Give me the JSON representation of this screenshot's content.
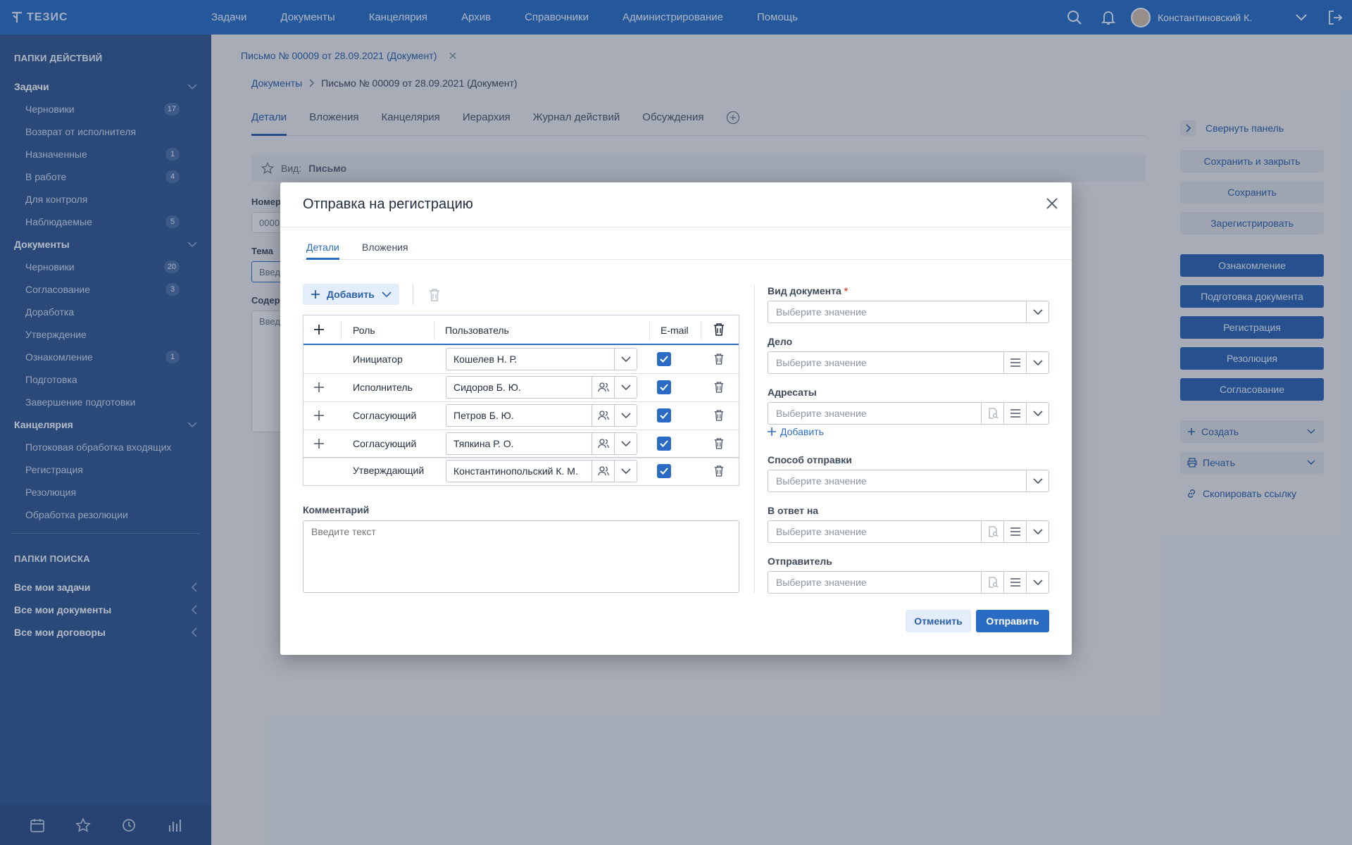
{
  "topbar": {
    "logo_text": "ТЕЗИС",
    "nav": [
      "Задачи",
      "Документы",
      "Канцелярия",
      "Архив",
      "Справочники",
      "Администрирование",
      "Помощь"
    ],
    "user_name": "Константиновский К."
  },
  "sidebar": {
    "folders_title": "ПАПКИ ДЕЙСТВИЙ",
    "groups": [
      {
        "label": "Задачи",
        "items": [
          {
            "label": "Черновики",
            "badge": "17"
          },
          {
            "label": "Возврат от исполнителя",
            "badge": ""
          },
          {
            "label": "Назначенные",
            "badge": "1"
          },
          {
            "label": "В работе",
            "badge": "4"
          },
          {
            "label": "Для контроля",
            "badge": ""
          },
          {
            "label": "Наблюдаемые",
            "badge": "5"
          }
        ]
      },
      {
        "label": "Документы",
        "items": [
          {
            "label": "Черновики",
            "badge": "20"
          },
          {
            "label": "Согласование",
            "badge": "3"
          },
          {
            "label": "Доработка",
            "badge": ""
          },
          {
            "label": "Утверждение",
            "badge": ""
          },
          {
            "label": "Ознакомление",
            "badge": "1"
          },
          {
            "label": "Подготовка",
            "badge": ""
          },
          {
            "label": "Завершение подготовки",
            "badge": ""
          }
        ]
      },
      {
        "label": "Канцелярия",
        "items": [
          {
            "label": "Потоковая обработка входящих",
            "badge": ""
          },
          {
            "label": "Регистрация",
            "badge": ""
          },
          {
            "label": "Резолюция",
            "badge": ""
          },
          {
            "label": "Обработка резолюции",
            "badge": ""
          }
        ]
      }
    ],
    "search_title": "ПАПКИ ПОИСКА",
    "search_items": [
      "Все мои задачи",
      "Все мои документы",
      "Все мои договоры"
    ]
  },
  "main": {
    "doc_tab": "Письмо № 00009 от 28.09.2021 (Документ)",
    "breadcrumb_root": "Документы",
    "breadcrumb_current": "Письмо № 00009 от 28.09.2021 (Документ)",
    "tabs": [
      "Детали",
      "Вложения",
      "Канцелярия",
      "Иерархия",
      "Журнал действий",
      "Обсуждения"
    ],
    "kind_label": "Вид:",
    "kind_value": "Письмо",
    "field_number": "Номер",
    "field_number_value": "0000",
    "field_subject": "Тема",
    "field_subject_value": "Введ",
    "field_content": "Содер",
    "field_content_value": "Введ"
  },
  "right_panel": {
    "collapse": "Свернуть панель",
    "save_close": "Сохранить и закрыть",
    "save": "Сохранить",
    "register": "Зарегистрировать",
    "actions": [
      "Ознакомление",
      "Подготовка документа",
      "Регистрация",
      "Резолюция",
      "Согласование"
    ],
    "create": "Создать",
    "print": "Печать",
    "copy_link": "Скопировать ссылку"
  },
  "dialog": {
    "title": "Отправка на регистрацию",
    "tabs": [
      "Детали",
      "Вложения"
    ],
    "add_button": "Добавить",
    "grid": {
      "headers": {
        "role": "Роль",
        "user": "Пользователь",
        "email": "E-mail"
      },
      "rows": [
        {
          "role": "Инициатор",
          "user": "Кошелев Н. Р.",
          "email": true
        },
        {
          "role": "Исполнитель",
          "user": "Сидоров Б. Ю.",
          "email": true
        },
        {
          "role": "Согласующий",
          "user": "Петров Б. Ю.",
          "email": true
        },
        {
          "role": "Согласующий",
          "user": "Тяпкина Р. О.",
          "email": true
        },
        {
          "role": "Утверждающий",
          "user": "Константинопольский К. М.",
          "email": true
        }
      ]
    },
    "comment_label": "Комментарий",
    "comment_placeholder": "Введите текст",
    "fields": {
      "doc_type_label": "Вид документа",
      "doc_type_required": "*",
      "case_label": "Дело",
      "addressees_label": "Адресаты",
      "addressees_add": "Добавить",
      "send_method_label": "Способ отправки",
      "reply_to_label": "В ответ на",
      "sender_label": "Отправитель",
      "placeholder": "Выберите значение"
    },
    "cancel_button": "Отменить",
    "send_button": "Отправить"
  },
  "colors": {
    "brand": "#2b6bbf",
    "sidebar": "#33578f",
    "accent": "#2a6bc4"
  }
}
